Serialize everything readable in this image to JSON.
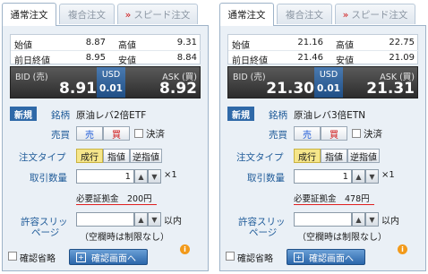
{
  "panels": [
    {
      "tabs": [
        {
          "label": "通常注文"
        },
        {
          "label": "複合注文"
        },
        {
          "label": "スピード注文"
        }
      ],
      "prices": {
        "open_label": "始値",
        "open": "8.87",
        "high_label": "高値",
        "high": "9.31",
        "prev_label": "前日終値",
        "prev": "8.95",
        "low_label": "安値",
        "low": "8.84"
      },
      "quote": {
        "bid_label": "BID (売)",
        "bid": "8.91",
        "currency": "USD",
        "spread": "0.01",
        "ask_label": "ASK (買)",
        "ask": "8.92"
      },
      "form": {
        "new_badge": "新規",
        "symbol_label": "銘柄",
        "symbol": "原油レバ2倍ETF",
        "side_label": "売買",
        "sell": "売",
        "buy": "買",
        "settle": "決済",
        "type_label": "注文タイプ",
        "type_market": "成行",
        "type_limit": "指値",
        "type_stop": "逆指値",
        "qty_label": "取引数量",
        "qty": "1",
        "multiplier": "×1",
        "margin": "必要証拠金　200円",
        "slip_label_1": "許容スリッ",
        "slip_label_2": "ページ",
        "slip_value": "",
        "slip_unit": "以内",
        "slip_note": "（空欄時は制限なし）",
        "skip_confirm": "確認省略",
        "confirm_button": "確認画面へ",
        "info": "i"
      }
    },
    {
      "tabs": [
        {
          "label": "通常注文"
        },
        {
          "label": "複合注文"
        },
        {
          "label": "スピード注文"
        }
      ],
      "prices": {
        "open_label": "始値",
        "open": "21.16",
        "high_label": "高値",
        "high": "22.75",
        "prev_label": "前日終値",
        "prev": "21.46",
        "low_label": "安値",
        "low": "21.09"
      },
      "quote": {
        "bid_label": "BID (売)",
        "bid": "21.30",
        "currency": "USD",
        "spread": "0.01",
        "ask_label": "ASK (買)",
        "ask": "21.31"
      },
      "form": {
        "new_badge": "新規",
        "symbol_label": "銘柄",
        "symbol": "原油レバ3倍ETN",
        "side_label": "売買",
        "sell": "売",
        "buy": "買",
        "settle": "決済",
        "type_label": "注文タイプ",
        "type_market": "成行",
        "type_limit": "指値",
        "type_stop": "逆指値",
        "qty_label": "取引数量",
        "qty": "1",
        "multiplier": "×1",
        "margin": "必要証拠金　478円",
        "slip_label_1": "許容スリッ",
        "slip_label_2": "ページ",
        "slip_value": "",
        "slip_unit": "以内",
        "slip_note": "（空欄時は制限なし）",
        "skip_confirm": "確認省略",
        "confirm_button": "確認画面へ",
        "info": "i"
      }
    }
  ]
}
